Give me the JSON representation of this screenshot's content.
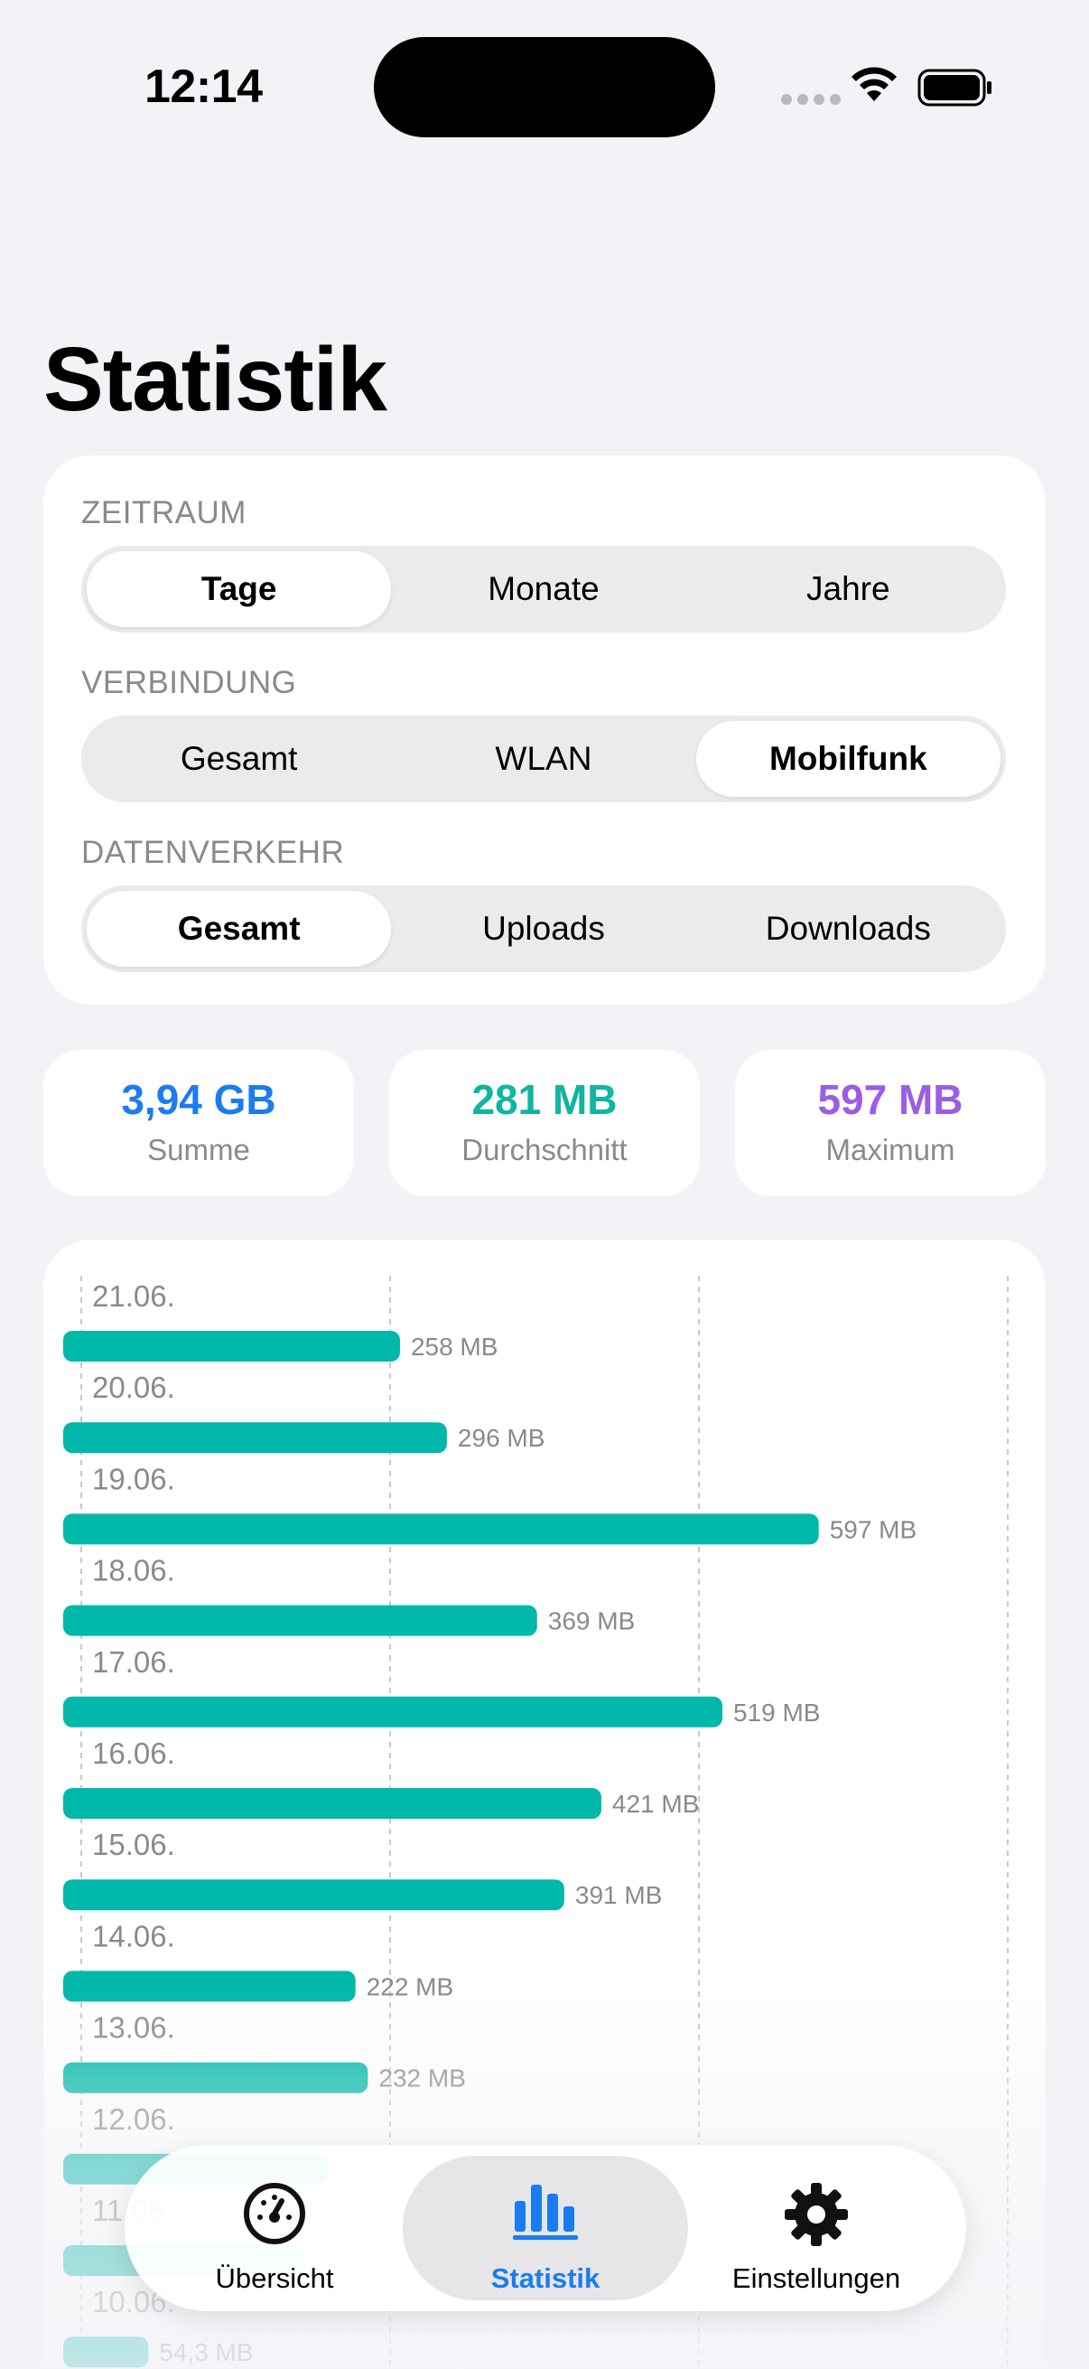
{
  "status_bar": {
    "time": "12:14"
  },
  "page_title": "Statistik",
  "filters": {
    "zeitraum": {
      "label": "ZEITRAUM",
      "options": [
        "Tage",
        "Monate",
        "Jahre"
      ],
      "selected": "Tage"
    },
    "verbindung": {
      "label": "VERBINDUNG",
      "options": [
        "Gesamt",
        "WLAN",
        "Mobilfunk"
      ],
      "selected": "Mobilfunk"
    },
    "datenverkehr": {
      "label": "DATENVERKEHR",
      "options": [
        "Gesamt",
        "Uploads",
        "Downloads"
      ],
      "selected": "Gesamt"
    }
  },
  "stats": {
    "sum": {
      "value": "3,94 GB",
      "label": "Summe",
      "color": "#1b7cf0"
    },
    "average": {
      "value": "281 MB",
      "label": "Durchschnitt",
      "color": "#12b5a1"
    },
    "maximum": {
      "value": "597 MB",
      "label": "Maximum",
      "color": "#9b5de5"
    }
  },
  "chart_data": {
    "type": "bar",
    "orientation": "horizontal",
    "bar_color": "#00b8a9",
    "categories": [
      "21.06.",
      "20.06.",
      "19.06.",
      "18.06.",
      "17.06.",
      "16.06.",
      "15.06.",
      "14.06.",
      "13.06.",
      "12.06.",
      "11.06.",
      "10.06."
    ],
    "values": [
      258,
      296,
      597,
      369,
      519,
      421,
      391,
      222,
      232,
      200,
      180,
      54.3
    ],
    "value_labels": [
      "258 MB",
      "296 MB",
      "597 MB",
      "369 MB",
      "519 MB",
      "421 MB",
      "391 MB",
      "222 MB",
      "232 MB",
      "",
      "",
      "54,3 MB"
    ],
    "unit": "MB",
    "xlim": [
      0,
      750
    ],
    "grid": "vertical dashed",
    "legend": "none"
  },
  "tab_bar": {
    "tabs": [
      {
        "label": "Übersicht",
        "icon": "gauge-icon",
        "active": false
      },
      {
        "label": "Statistik",
        "icon": "bar-chart-icon",
        "active": true
      },
      {
        "label": "Einstellungen",
        "icon": "gear-icon",
        "active": false
      }
    ]
  }
}
